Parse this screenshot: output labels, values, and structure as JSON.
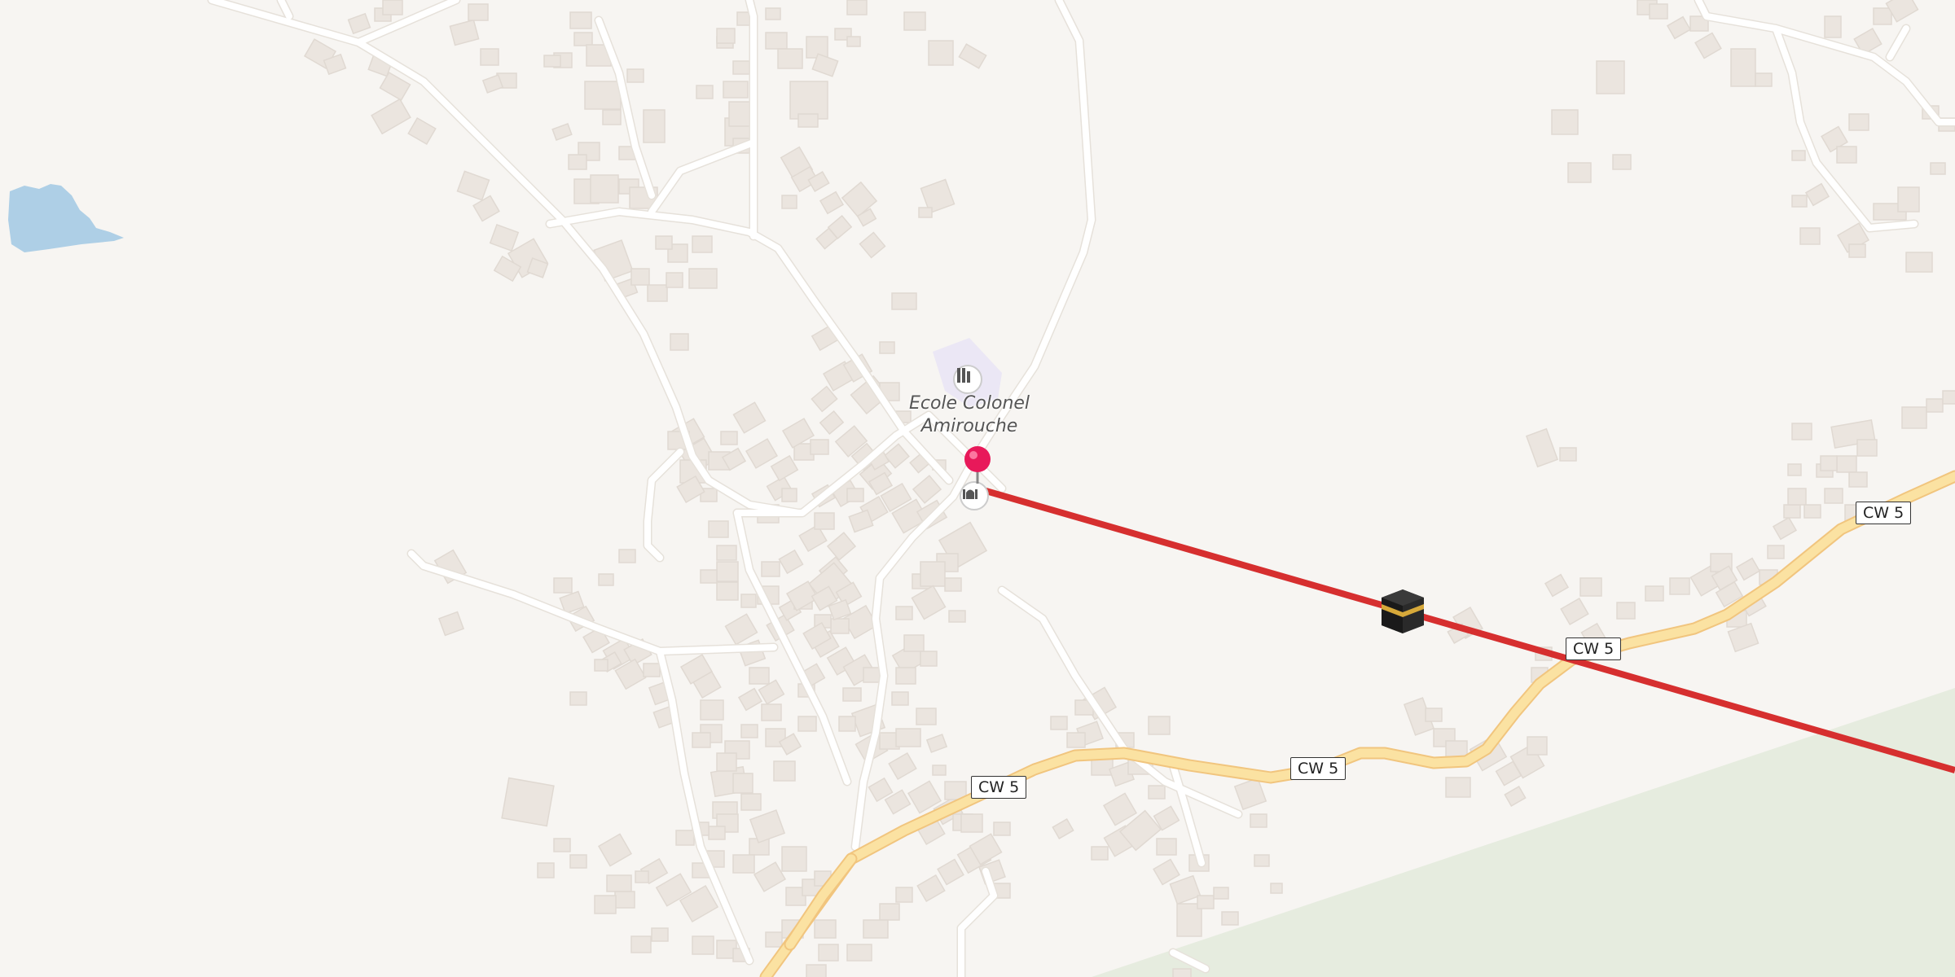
{
  "map": {
    "poi_school_name_line1": "Ecole Colonel",
    "poi_school_name_line2": "Amirouche",
    "road_ref": "CW 5",
    "icons": [
      "school-icon",
      "mosque-icon",
      "location-pin-icon",
      "kaaba-icon"
    ],
    "colors": {
      "background": "#f7f5f2",
      "building": "#ebe6e1",
      "minor_road": "#ffffff",
      "secondary_road": "#fbe3a0",
      "water": "#a9cde6",
      "forest": "#e5ecdf",
      "qibla_line": "#d62f2f",
      "pin": "#e8195a",
      "school_area": "#ece8f6"
    }
  }
}
